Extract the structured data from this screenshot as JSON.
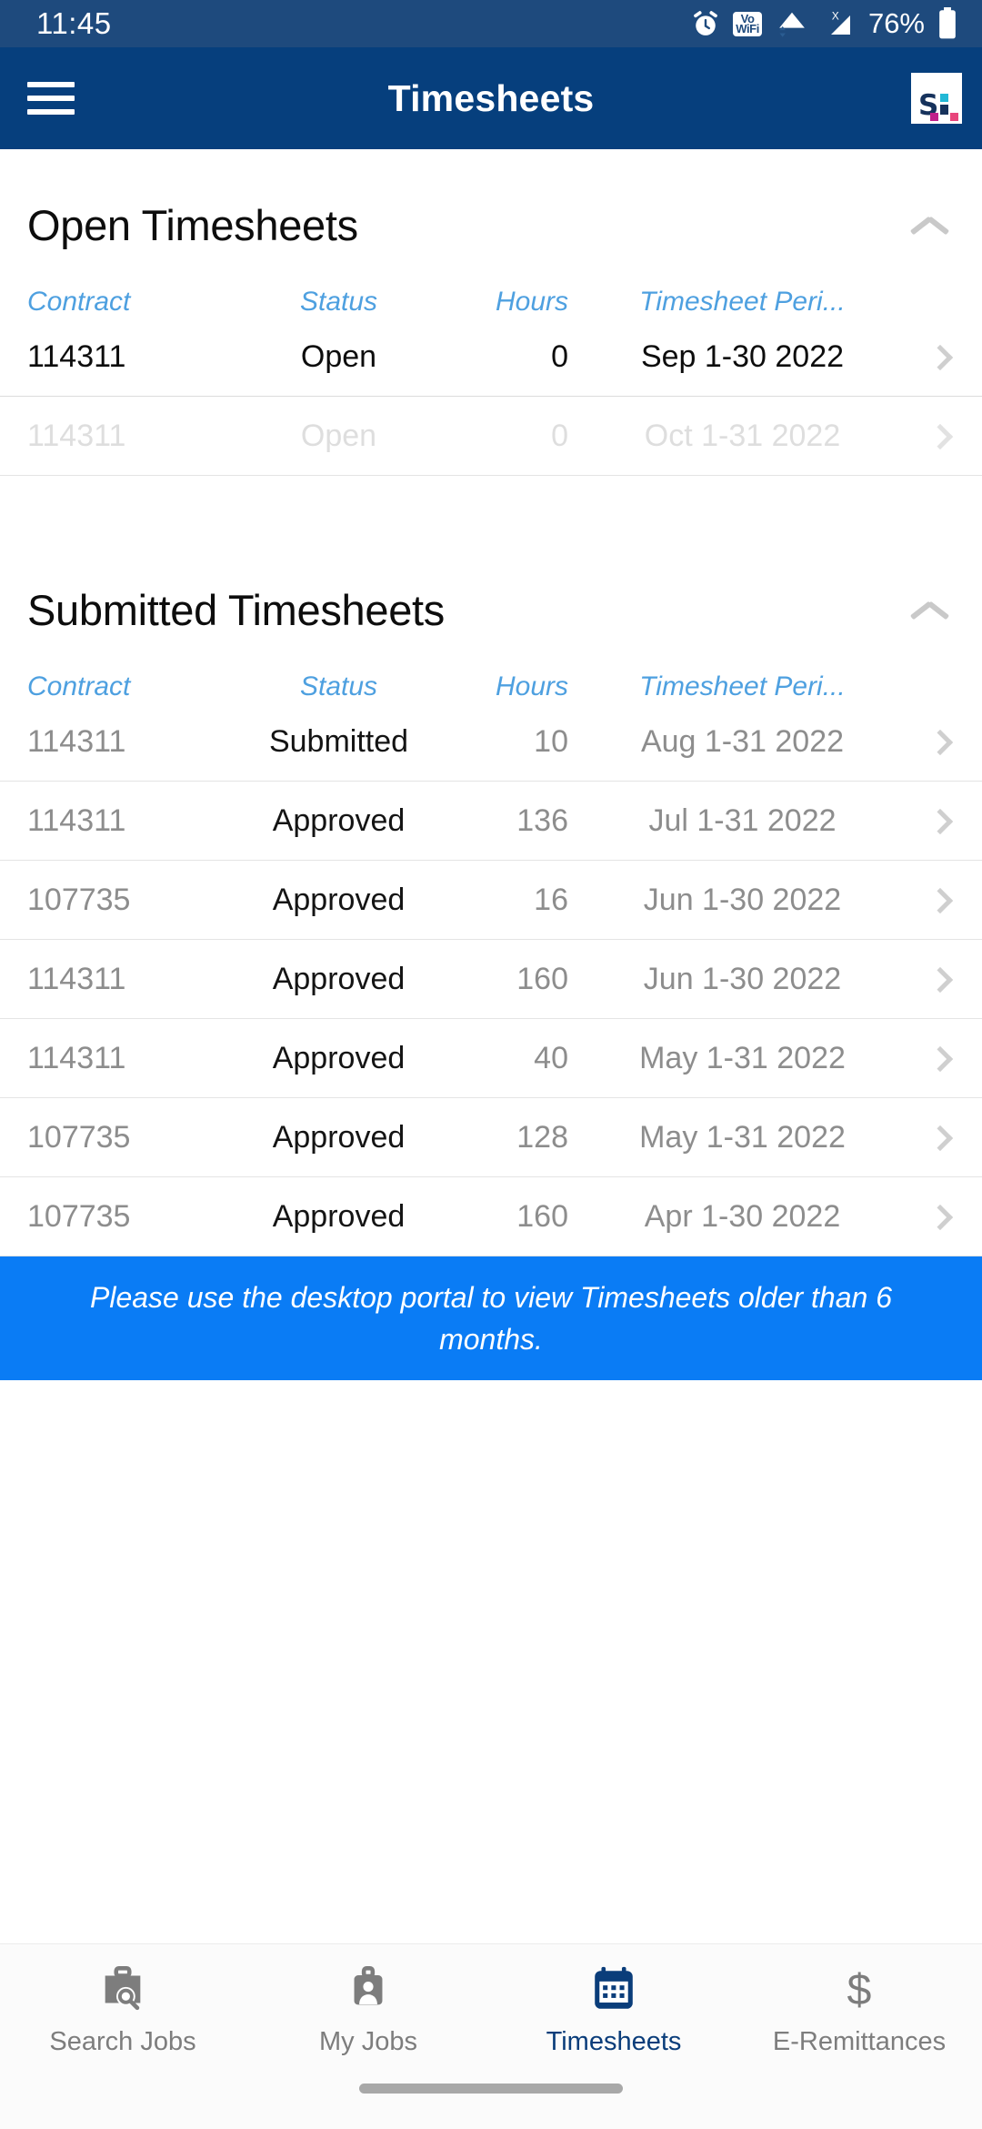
{
  "status_bar": {
    "time": "11:45",
    "battery_percent": "76%",
    "vowifi_top": "Vo",
    "vowifi_bottom": "WiFi",
    "icons": [
      "alarm-clock-icon",
      "volte-wifi-icon",
      "wifi-icon",
      "cellular-no-sim-icon",
      "battery-icon"
    ]
  },
  "app_bar": {
    "title": "Timesheets",
    "menu_icon": "hamburger-menu-icon",
    "logo_text": "S.i.",
    "logo_letter": "S.",
    "brand_navy": "#16325c",
    "brand_cyan": "#22b8d6",
    "brand_pink": "#e8457c",
    "brand_magenta": "#c0208a",
    "bar_color": "#063f7d"
  },
  "columns": {
    "contract": "Contract",
    "status": "Status",
    "hours": "Hours",
    "period": "Timesheet Peri...",
    "header_color": "#4ea0e0"
  },
  "open_section": {
    "title": "Open Timesheets",
    "collapse_icon": "chevron-up-icon",
    "rows": [
      {
        "contract": "114311",
        "status": "Open",
        "hours": "0",
        "period": "Sep 1-30 2022",
        "state": "active"
      },
      {
        "contract": "114311",
        "status": "Open",
        "hours": "0",
        "period": "Oct 1-31 2022",
        "state": "faded"
      }
    ]
  },
  "submitted_section": {
    "title": "Submitted Timesheets",
    "collapse_icon": "chevron-up-icon",
    "rows": [
      {
        "contract": "114311",
        "status": "Submitted",
        "hours": "10",
        "period": "Aug 1-31 2022"
      },
      {
        "contract": "114311",
        "status": "Approved",
        "hours": "136",
        "period": "Jul 1-31 2022"
      },
      {
        "contract": "107735",
        "status": "Approved",
        "hours": "16",
        "period": "Jun 1-30 2022"
      },
      {
        "contract": "114311",
        "status": "Approved",
        "hours": "160",
        "period": "Jun 1-30 2022"
      },
      {
        "contract": "114311",
        "status": "Approved",
        "hours": "40",
        "period": "May 1-31 2022"
      },
      {
        "contract": "107735",
        "status": "Approved",
        "hours": "128",
        "period": "May 1-31 2022"
      },
      {
        "contract": "107735",
        "status": "Approved",
        "hours": "160",
        "period": "Apr 1-30 2022"
      }
    ]
  },
  "notice": {
    "text": "Please use the desktop portal to view Timesheets older than 6 months.",
    "background": "#0a7cf5"
  },
  "bottom_nav": {
    "active_color": "#0a3d7a",
    "inactive_color": "#7d7d7d",
    "items": [
      {
        "label": "Search Jobs",
        "icon": "briefcase-search-icon",
        "active": false
      },
      {
        "label": "My Jobs",
        "icon": "id-badge-icon",
        "active": false
      },
      {
        "label": "Timesheets",
        "icon": "calendar-icon",
        "active": true
      },
      {
        "label": "E-Remittances",
        "icon": "dollar-sign-icon",
        "active": false
      }
    ]
  }
}
